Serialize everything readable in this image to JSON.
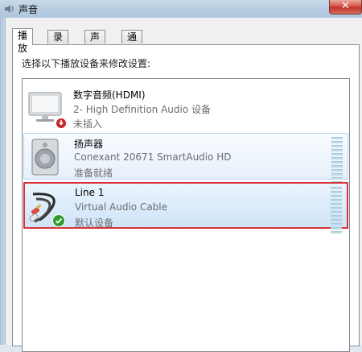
{
  "window": {
    "title": "声音",
    "close_glyph": "✕"
  },
  "tabs": [
    {
      "label": "播放",
      "active": true
    },
    {
      "label": "录制",
      "active": false
    },
    {
      "label": "声音",
      "active": false
    },
    {
      "label": "通信",
      "active": false
    }
  ],
  "prompt": "选择以下播放设备来修改设置:",
  "devices": [
    {
      "name": "数字音频(HDMI)",
      "description": "2- High Definition Audio 设备",
      "status": "未插入",
      "icon": "monitor-icon",
      "badge": "unplugged-red-badge"
    },
    {
      "name": "扬声器",
      "description": "Conexant 20671 SmartAudio HD",
      "status": "准备就绪",
      "icon": "speaker-icon"
    },
    {
      "name": "Line 1",
      "description": "Virtual Audio Cable",
      "status": "默认设备",
      "icon": "audio-cable-icon",
      "badge": "default-green-check"
    }
  ],
  "colors": {
    "selection_border": "#d8333a",
    "default_badge": "#2e9b2e",
    "unplugged_badge": "#c62828"
  }
}
